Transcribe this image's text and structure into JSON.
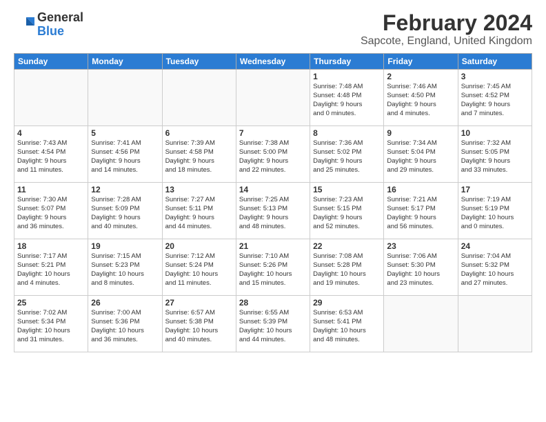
{
  "logo": {
    "general": "General",
    "blue": "Blue"
  },
  "title": {
    "month_year": "February 2024",
    "location": "Sapcote, England, United Kingdom"
  },
  "headers": [
    "Sunday",
    "Monday",
    "Tuesday",
    "Wednesday",
    "Thursday",
    "Friday",
    "Saturday"
  ],
  "weeks": [
    [
      {
        "day": "",
        "info": ""
      },
      {
        "day": "",
        "info": ""
      },
      {
        "day": "",
        "info": ""
      },
      {
        "day": "",
        "info": ""
      },
      {
        "day": "1",
        "info": "Sunrise: 7:48 AM\nSunset: 4:48 PM\nDaylight: 9 hours\nand 0 minutes."
      },
      {
        "day": "2",
        "info": "Sunrise: 7:46 AM\nSunset: 4:50 PM\nDaylight: 9 hours\nand 4 minutes."
      },
      {
        "day": "3",
        "info": "Sunrise: 7:45 AM\nSunset: 4:52 PM\nDaylight: 9 hours\nand 7 minutes."
      }
    ],
    [
      {
        "day": "4",
        "info": "Sunrise: 7:43 AM\nSunset: 4:54 PM\nDaylight: 9 hours\nand 11 minutes."
      },
      {
        "day": "5",
        "info": "Sunrise: 7:41 AM\nSunset: 4:56 PM\nDaylight: 9 hours\nand 14 minutes."
      },
      {
        "day": "6",
        "info": "Sunrise: 7:39 AM\nSunset: 4:58 PM\nDaylight: 9 hours\nand 18 minutes."
      },
      {
        "day": "7",
        "info": "Sunrise: 7:38 AM\nSunset: 5:00 PM\nDaylight: 9 hours\nand 22 minutes."
      },
      {
        "day": "8",
        "info": "Sunrise: 7:36 AM\nSunset: 5:02 PM\nDaylight: 9 hours\nand 25 minutes."
      },
      {
        "day": "9",
        "info": "Sunrise: 7:34 AM\nSunset: 5:04 PM\nDaylight: 9 hours\nand 29 minutes."
      },
      {
        "day": "10",
        "info": "Sunrise: 7:32 AM\nSunset: 5:05 PM\nDaylight: 9 hours\nand 33 minutes."
      }
    ],
    [
      {
        "day": "11",
        "info": "Sunrise: 7:30 AM\nSunset: 5:07 PM\nDaylight: 9 hours\nand 36 minutes."
      },
      {
        "day": "12",
        "info": "Sunrise: 7:28 AM\nSunset: 5:09 PM\nDaylight: 9 hours\nand 40 minutes."
      },
      {
        "day": "13",
        "info": "Sunrise: 7:27 AM\nSunset: 5:11 PM\nDaylight: 9 hours\nand 44 minutes."
      },
      {
        "day": "14",
        "info": "Sunrise: 7:25 AM\nSunset: 5:13 PM\nDaylight: 9 hours\nand 48 minutes."
      },
      {
        "day": "15",
        "info": "Sunrise: 7:23 AM\nSunset: 5:15 PM\nDaylight: 9 hours\nand 52 minutes."
      },
      {
        "day": "16",
        "info": "Sunrise: 7:21 AM\nSunset: 5:17 PM\nDaylight: 9 hours\nand 56 minutes."
      },
      {
        "day": "17",
        "info": "Sunrise: 7:19 AM\nSunset: 5:19 PM\nDaylight: 10 hours\nand 0 minutes."
      }
    ],
    [
      {
        "day": "18",
        "info": "Sunrise: 7:17 AM\nSunset: 5:21 PM\nDaylight: 10 hours\nand 4 minutes."
      },
      {
        "day": "19",
        "info": "Sunrise: 7:15 AM\nSunset: 5:23 PM\nDaylight: 10 hours\nand 8 minutes."
      },
      {
        "day": "20",
        "info": "Sunrise: 7:12 AM\nSunset: 5:24 PM\nDaylight: 10 hours\nand 11 minutes."
      },
      {
        "day": "21",
        "info": "Sunrise: 7:10 AM\nSunset: 5:26 PM\nDaylight: 10 hours\nand 15 minutes."
      },
      {
        "day": "22",
        "info": "Sunrise: 7:08 AM\nSunset: 5:28 PM\nDaylight: 10 hours\nand 19 minutes."
      },
      {
        "day": "23",
        "info": "Sunrise: 7:06 AM\nSunset: 5:30 PM\nDaylight: 10 hours\nand 23 minutes."
      },
      {
        "day": "24",
        "info": "Sunrise: 7:04 AM\nSunset: 5:32 PM\nDaylight: 10 hours\nand 27 minutes."
      }
    ],
    [
      {
        "day": "25",
        "info": "Sunrise: 7:02 AM\nSunset: 5:34 PM\nDaylight: 10 hours\nand 31 minutes."
      },
      {
        "day": "26",
        "info": "Sunrise: 7:00 AM\nSunset: 5:36 PM\nDaylight: 10 hours\nand 36 minutes."
      },
      {
        "day": "27",
        "info": "Sunrise: 6:57 AM\nSunset: 5:38 PM\nDaylight: 10 hours\nand 40 minutes."
      },
      {
        "day": "28",
        "info": "Sunrise: 6:55 AM\nSunset: 5:39 PM\nDaylight: 10 hours\nand 44 minutes."
      },
      {
        "day": "29",
        "info": "Sunrise: 6:53 AM\nSunset: 5:41 PM\nDaylight: 10 hours\nand 48 minutes."
      },
      {
        "day": "",
        "info": ""
      },
      {
        "day": "",
        "info": ""
      }
    ]
  ]
}
